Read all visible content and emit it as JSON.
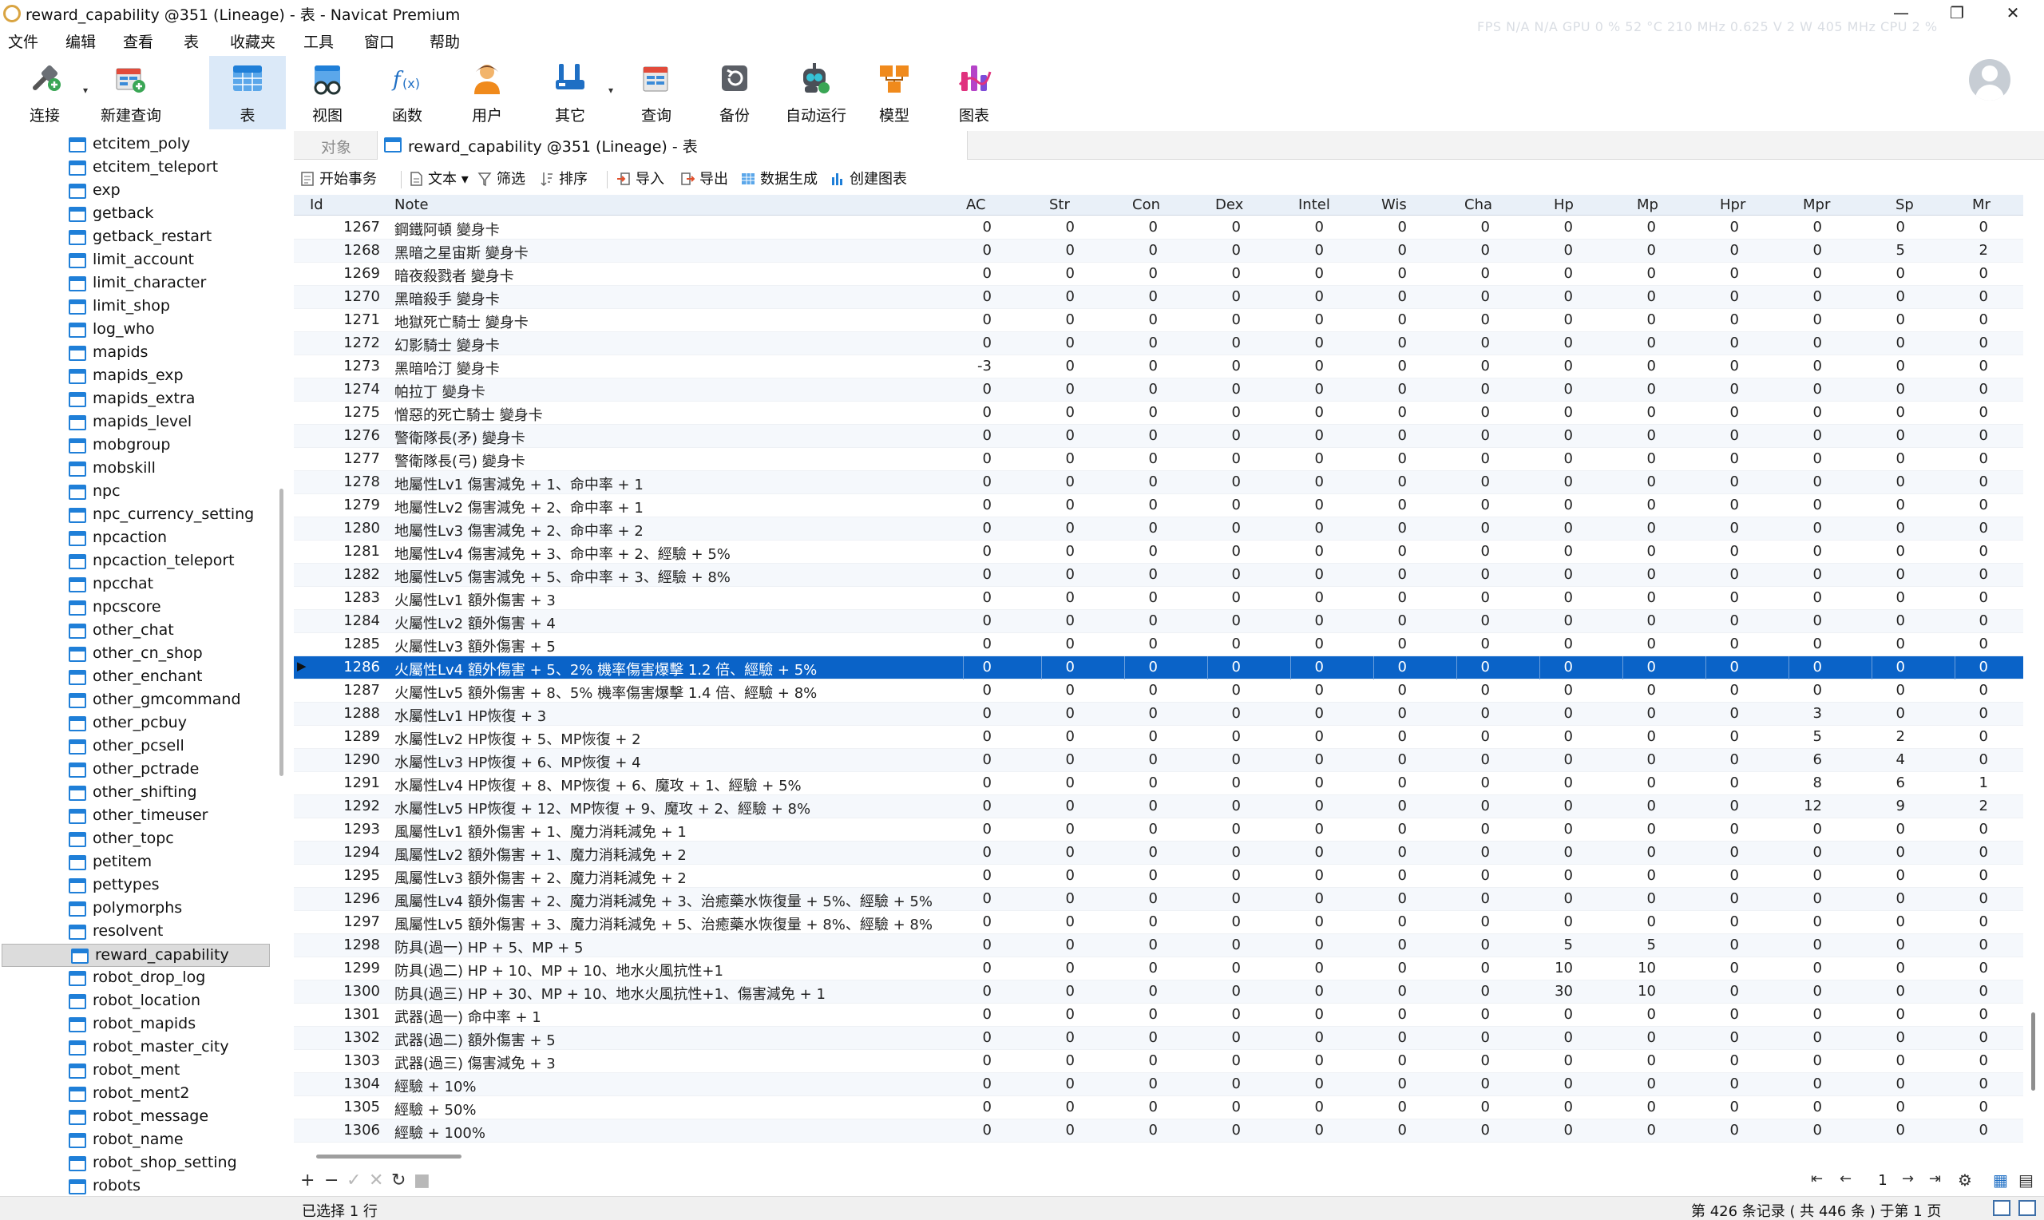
{
  "window": {
    "title": "reward_capability @351 (Lineage) - 表 - Navicat Premium",
    "overlay_stats": "FPS  N/A   N/A    GPU  0 %   52 °C  210 MHz  0.625 V   2 W   405 MHz    CPU   2 %"
  },
  "menu": [
    "文件",
    "编辑",
    "查看",
    "表",
    "收藏夹",
    "工具",
    "窗口",
    "帮助"
  ],
  "ribbon": {
    "connect": "连接",
    "new_query": "新建查询",
    "table": "表",
    "view": "视图",
    "function": "函数",
    "user": "用户",
    "other": "其它",
    "query": "查询",
    "backup": "备份",
    "automation": "自动运行",
    "model": "模型",
    "chart": "图表"
  },
  "navigator": {
    "items": [
      "etcitem_poly",
      "etcitem_teleport",
      "exp",
      "getback",
      "getback_restart",
      "limit_account",
      "limit_character",
      "limit_shop",
      "log_who",
      "mapids",
      "mapids_exp",
      "mapids_extra",
      "mapids_level",
      "mobgroup",
      "mobskill",
      "npc",
      "npc_currency_setting",
      "npcaction",
      "npcaction_teleport",
      "npcchat",
      "npcscore",
      "other_chat",
      "other_cn_shop",
      "other_enchant",
      "other_gmcommand",
      "other_pcbuy",
      "other_pcsell",
      "other_pctrade",
      "other_shifting",
      "other_timeuser",
      "other_topc",
      "petitem",
      "pettypes",
      "polymorphs",
      "resolvent",
      "reward_capability",
      "robot_drop_log",
      "robot_location",
      "robot_mapids",
      "robot_master_city",
      "robot_ment",
      "robot_ment2",
      "robot_message",
      "robot_name",
      "robot_shop_setting",
      "robots"
    ],
    "selected": "reward_capability"
  },
  "tabs": {
    "objects": "对象",
    "active": "reward_capability @351 (Lineage) - 表"
  },
  "subtoolbar": {
    "begin_transaction": "开始事务",
    "text": "文本",
    "filter": "筛选",
    "sort": "排序",
    "import": "导入",
    "export": "导出",
    "data_generation": "数据生成",
    "create_chart": "创建图表"
  },
  "grid": {
    "columns": [
      "Id",
      "Note",
      "AC",
      "Str",
      "Con",
      "Dex",
      "Intel",
      "Wis",
      "Cha",
      "Hp",
      "Mp",
      "Hpr",
      "Mpr",
      "Sp",
      "Mr"
    ],
    "selected_id": 1286,
    "rows": [
      [
        1267,
        "鋼鐵阿頓 變身卡",
        0,
        0,
        0,
        0,
        0,
        0,
        0,
        0,
        0,
        0,
        0,
        0,
        0
      ],
      [
        1268,
        "黑暗之星宙斯 變身卡",
        0,
        0,
        0,
        0,
        0,
        0,
        0,
        0,
        0,
        0,
        0,
        5,
        2
      ],
      [
        1269,
        "暗夜殺戮者 變身卡",
        0,
        0,
        0,
        0,
        0,
        0,
        0,
        0,
        0,
        0,
        0,
        0,
        0
      ],
      [
        1270,
        "黑暗殺手 變身卡",
        0,
        0,
        0,
        0,
        0,
        0,
        0,
        0,
        0,
        0,
        0,
        0,
        0
      ],
      [
        1271,
        "地獄死亡騎士 變身卡",
        0,
        0,
        0,
        0,
        0,
        0,
        0,
        0,
        0,
        0,
        0,
        0,
        0
      ],
      [
        1272,
        "幻影騎士 變身卡",
        0,
        0,
        0,
        0,
        0,
        0,
        0,
        0,
        0,
        0,
        0,
        0,
        0
      ],
      [
        1273,
        "黑暗哈汀 變身卡",
        -3,
        0,
        0,
        0,
        0,
        0,
        0,
        0,
        0,
        0,
        0,
        0,
        0
      ],
      [
        1274,
        "帕拉丁 變身卡",
        0,
        0,
        0,
        0,
        0,
        0,
        0,
        0,
        0,
        0,
        0,
        0,
        0
      ],
      [
        1275,
        "憎惡的死亡騎士 變身卡",
        0,
        0,
        0,
        0,
        0,
        0,
        0,
        0,
        0,
        0,
        0,
        0,
        0
      ],
      [
        1276,
        "警衛隊長(矛) 變身卡",
        0,
        0,
        0,
        0,
        0,
        0,
        0,
        0,
        0,
        0,
        0,
        0,
        0
      ],
      [
        1277,
        "警衛隊長(弓) 變身卡",
        0,
        0,
        0,
        0,
        0,
        0,
        0,
        0,
        0,
        0,
        0,
        0,
        0
      ],
      [
        1278,
        "地屬性Lv1 傷害減免 + 1、命中率 + 1",
        0,
        0,
        0,
        0,
        0,
        0,
        0,
        0,
        0,
        0,
        0,
        0,
        0
      ],
      [
        1279,
        "地屬性Lv2 傷害減免 + 2、命中率 + 1",
        0,
        0,
        0,
        0,
        0,
        0,
        0,
        0,
        0,
        0,
        0,
        0,
        0
      ],
      [
        1280,
        "地屬性Lv3 傷害減免 + 2、命中率 + 2",
        0,
        0,
        0,
        0,
        0,
        0,
        0,
        0,
        0,
        0,
        0,
        0,
        0
      ],
      [
        1281,
        "地屬性Lv4 傷害減免 + 3、命中率 + 2、經驗 + 5%",
        0,
        0,
        0,
        0,
        0,
        0,
        0,
        0,
        0,
        0,
        0,
        0,
        0
      ],
      [
        1282,
        "地屬性Lv5 傷害減免 + 5、命中率 + 3、經驗 + 8%",
        0,
        0,
        0,
        0,
        0,
        0,
        0,
        0,
        0,
        0,
        0,
        0,
        0
      ],
      [
        1283,
        "火屬性Lv1 額外傷害 + 3",
        0,
        0,
        0,
        0,
        0,
        0,
        0,
        0,
        0,
        0,
        0,
        0,
        0
      ],
      [
        1284,
        "火屬性Lv2 額外傷害 + 4",
        0,
        0,
        0,
        0,
        0,
        0,
        0,
        0,
        0,
        0,
        0,
        0,
        0
      ],
      [
        1285,
        "火屬性Lv3 額外傷害 + 5",
        0,
        0,
        0,
        0,
        0,
        0,
        0,
        0,
        0,
        0,
        0,
        0,
        0
      ],
      [
        1286,
        "火屬性Lv4 額外傷害 + 5、2% 機率傷害爆擊 1.2 倍、經驗 + 5%",
        0,
        0,
        0,
        0,
        0,
        0,
        0,
        0,
        0,
        0,
        0,
        0,
        0
      ],
      [
        1287,
        "火屬性Lv5 額外傷害 + 8、5% 機率傷害爆擊 1.4 倍、經驗 + 8%",
        0,
        0,
        0,
        0,
        0,
        0,
        0,
        0,
        0,
        0,
        0,
        0,
        0
      ],
      [
        1288,
        "水屬性Lv1 HP恢復 + 3",
        0,
        0,
        0,
        0,
        0,
        0,
        0,
        0,
        0,
        0,
        3,
        0,
        0
      ],
      [
        1289,
        "水屬性Lv2 HP恢復 + 5、MP恢復 + 2",
        0,
        0,
        0,
        0,
        0,
        0,
        0,
        0,
        0,
        0,
        5,
        2,
        0
      ],
      [
        1290,
        "水屬性Lv3 HP恢復 + 6、MP恢復 + 4",
        0,
        0,
        0,
        0,
        0,
        0,
        0,
        0,
        0,
        0,
        6,
        4,
        0
      ],
      [
        1291,
        "水屬性Lv4 HP恢復 + 8、MP恢復 + 6、魔攻 + 1、經驗 + 5%",
        0,
        0,
        0,
        0,
        0,
        0,
        0,
        0,
        0,
        0,
        8,
        6,
        1
      ],
      [
        1292,
        "水屬性Lv5 HP恢復 + 12、MP恢復 + 9、魔攻 + 2、經驗 + 8%",
        0,
        0,
        0,
        0,
        0,
        0,
        0,
        0,
        0,
        0,
        12,
        9,
        2
      ],
      [
        1293,
        "風屬性Lv1 額外傷害 + 1、魔力消耗減免 + 1",
        0,
        0,
        0,
        0,
        0,
        0,
        0,
        0,
        0,
        0,
        0,
        0,
        0
      ],
      [
        1294,
        "風屬性Lv2 額外傷害 + 1、魔力消耗減免 + 2",
        0,
        0,
        0,
        0,
        0,
        0,
        0,
        0,
        0,
        0,
        0,
        0,
        0
      ],
      [
        1295,
        "風屬性Lv3 額外傷害 + 2、魔力消耗減免 + 2",
        0,
        0,
        0,
        0,
        0,
        0,
        0,
        0,
        0,
        0,
        0,
        0,
        0
      ],
      [
        1296,
        "風屬性Lv4 額外傷害 + 2、魔力消耗減免 + 3、治癒藥水恢復量 + 5%、經驗 + 5%",
        0,
        0,
        0,
        0,
        0,
        0,
        0,
        0,
        0,
        0,
        0,
        0,
        0
      ],
      [
        1297,
        "風屬性Lv5 額外傷害 + 3、魔力消耗減免 + 5、治癒藥水恢復量 + 8%、經驗 + 8%",
        0,
        0,
        0,
        0,
        0,
        0,
        0,
        0,
        0,
        0,
        0,
        0,
        0
      ],
      [
        1298,
        "防具(過一) HP + 5、MP + 5",
        0,
        0,
        0,
        0,
        0,
        0,
        0,
        5,
        5,
        0,
        0,
        0,
        0
      ],
      [
        1299,
        "防具(過二) HP + 10、MP + 10、地水火風抗性+1",
        0,
        0,
        0,
        0,
        0,
        0,
        0,
        10,
        10,
        0,
        0,
        0,
        0
      ],
      [
        1300,
        "防具(過三) HP + 30、MP + 10、地水火風抗性+1、傷害減免 + 1",
        0,
        0,
        0,
        0,
        0,
        0,
        0,
        30,
        10,
        0,
        0,
        0,
        0
      ],
      [
        1301,
        "武器(過一) 命中率 + 1",
        0,
        0,
        0,
        0,
        0,
        0,
        0,
        0,
        0,
        0,
        0,
        0,
        0
      ],
      [
        1302,
        "武器(過二) 額外傷害 + 5",
        0,
        0,
        0,
        0,
        0,
        0,
        0,
        0,
        0,
        0,
        0,
        0,
        0
      ],
      [
        1303,
        "武器(過三) 傷害減免 + 3",
        0,
        0,
        0,
        0,
        0,
        0,
        0,
        0,
        0,
        0,
        0,
        0,
        0
      ],
      [
        1304,
        "經驗 + 10%",
        0,
        0,
        0,
        0,
        0,
        0,
        0,
        0,
        0,
        0,
        0,
        0,
        0
      ],
      [
        1305,
        "經驗 + 50%",
        0,
        0,
        0,
        0,
        0,
        0,
        0,
        0,
        0,
        0,
        0,
        0,
        0
      ],
      [
        1306,
        "經驗 + 100%",
        0,
        0,
        0,
        0,
        0,
        0,
        0,
        0,
        0,
        0,
        0,
        0,
        0
      ]
    ]
  },
  "pager": {
    "page": "1"
  },
  "status": {
    "left": "已选择 1 行",
    "right": "第 426 条记录 ( 共 446 条 ) 于第 1 页"
  },
  "colors": {
    "accent": "#0a63c8",
    "table_icon": "#1f7fd8",
    "active_ribbon": "#dbe9f8"
  }
}
